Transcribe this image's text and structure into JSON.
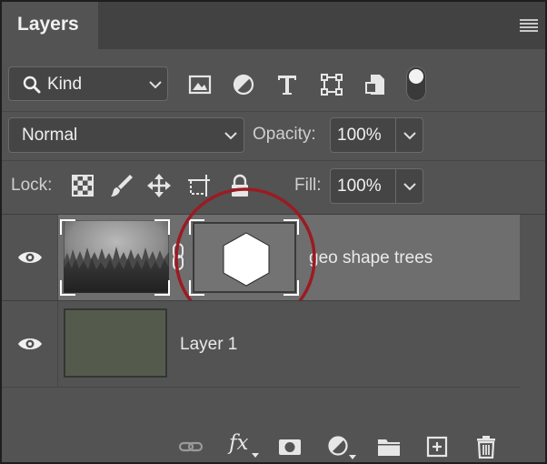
{
  "panel": {
    "tab_title": "Layers"
  },
  "filter": {
    "kind_label": "Kind",
    "filter_icons": [
      "image-filter-icon",
      "adjustment-filter-icon",
      "type-filter-icon",
      "shape-filter-icon",
      "smart-object-filter-icon"
    ],
    "toggle_on": true
  },
  "blend": {
    "mode": "Normal",
    "opacity_label": "Opacity:",
    "opacity_value": "100%"
  },
  "lock": {
    "label": "Lock:",
    "fill_label": "Fill:",
    "fill_value": "100%"
  },
  "layers": [
    {
      "name": "geo shape trees",
      "visible": true,
      "selected": true,
      "has_mask": true,
      "linked": true
    },
    {
      "name": "Layer 1",
      "visible": true,
      "selected": false,
      "has_mask": false
    }
  ],
  "toolbar": {
    "fx_label": "fx"
  },
  "colors": {
    "panel_bg": "#535353",
    "selected_row": "#6e6e6e",
    "highlight_circle": "#9b1b22",
    "layer1_fill": "#545b4d"
  }
}
